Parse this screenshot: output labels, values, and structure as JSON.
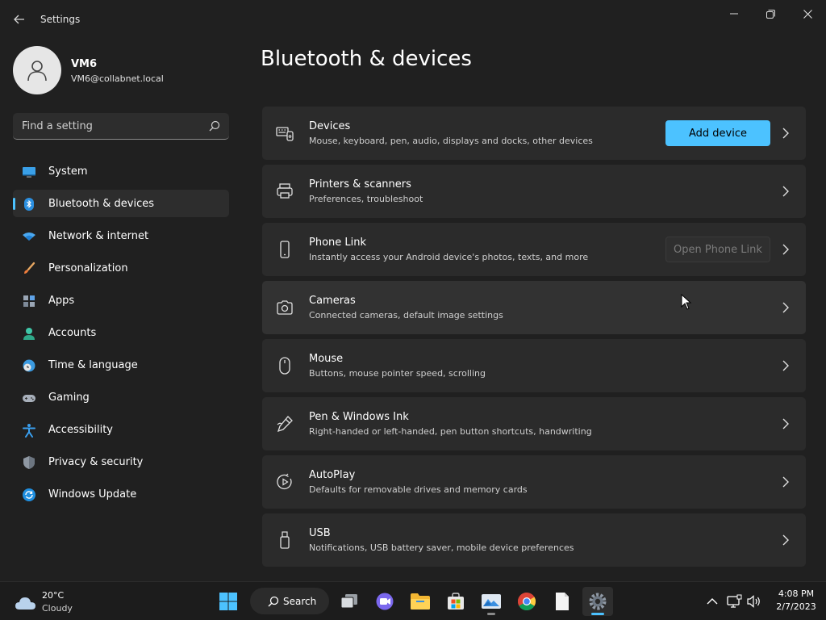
{
  "window": {
    "title": "Settings"
  },
  "user": {
    "name": "VM6",
    "email": "VM6@collabnet.local"
  },
  "search": {
    "placeholder": "Find a setting"
  },
  "nav": {
    "items": [
      {
        "label": "System",
        "icon": "monitor-icon",
        "active": false
      },
      {
        "label": "Bluetooth & devices",
        "icon": "bluetooth-icon",
        "active": true
      },
      {
        "label": "Network & internet",
        "icon": "wifi-icon",
        "active": false
      },
      {
        "label": "Personalization",
        "icon": "paintbrush-icon",
        "active": false
      },
      {
        "label": "Apps",
        "icon": "apps-icon",
        "active": false
      },
      {
        "label": "Accounts",
        "icon": "person-icon",
        "active": false
      },
      {
        "label": "Time & language",
        "icon": "globe-clock-icon",
        "active": false
      },
      {
        "label": "Gaming",
        "icon": "gamepad-icon",
        "active": false
      },
      {
        "label": "Accessibility",
        "icon": "accessibility-icon",
        "active": false
      },
      {
        "label": "Privacy & security",
        "icon": "shield-icon",
        "active": false
      },
      {
        "label": "Windows Update",
        "icon": "update-icon",
        "active": false
      }
    ]
  },
  "main": {
    "title": "Bluetooth & devices",
    "cards": [
      {
        "title": "Devices",
        "subtitle": "Mouse, keyboard, pen, audio, displays and docks, other devices",
        "icon": "devices-icon",
        "button": "Add device"
      },
      {
        "title": "Printers & scanners",
        "subtitle": "Preferences, troubleshoot",
        "icon": "printer-icon"
      },
      {
        "title": "Phone Link",
        "subtitle": "Instantly access your Android device's photos, texts, and more",
        "icon": "phone-icon",
        "button": "Open Phone Link"
      },
      {
        "title": "Cameras",
        "subtitle": "Connected cameras, default image settings",
        "icon": "camera-icon"
      },
      {
        "title": "Mouse",
        "subtitle": "Buttons, mouse pointer speed, scrolling",
        "icon": "mouse-icon"
      },
      {
        "title": "Pen & Windows Ink",
        "subtitle": "Right-handed or left-handed, pen button shortcuts, handwriting",
        "icon": "pen-icon"
      },
      {
        "title": "AutoPlay",
        "subtitle": "Defaults for removable drives and memory cards",
        "icon": "autoplay-icon"
      },
      {
        "title": "USB",
        "subtitle": "Notifications, USB battery saver, mobile device preferences",
        "icon": "usb-icon"
      }
    ]
  },
  "taskbar": {
    "weather": {
      "temp": "20°C",
      "condition": "Cloudy"
    },
    "search_label": "Search",
    "apps": [
      "start-icon",
      "task-view-icon",
      "chat-icon",
      "file-explorer-icon",
      "store-icon",
      "photos-icon",
      "chrome-icon",
      "notepad-icon",
      "settings-icon"
    ],
    "clock": {
      "time": "4:08 PM",
      "date": "2/7/2023"
    }
  },
  "colors": {
    "accent": "#4cc2ff",
    "background": "#202020",
    "card": "#2b2b2b"
  }
}
